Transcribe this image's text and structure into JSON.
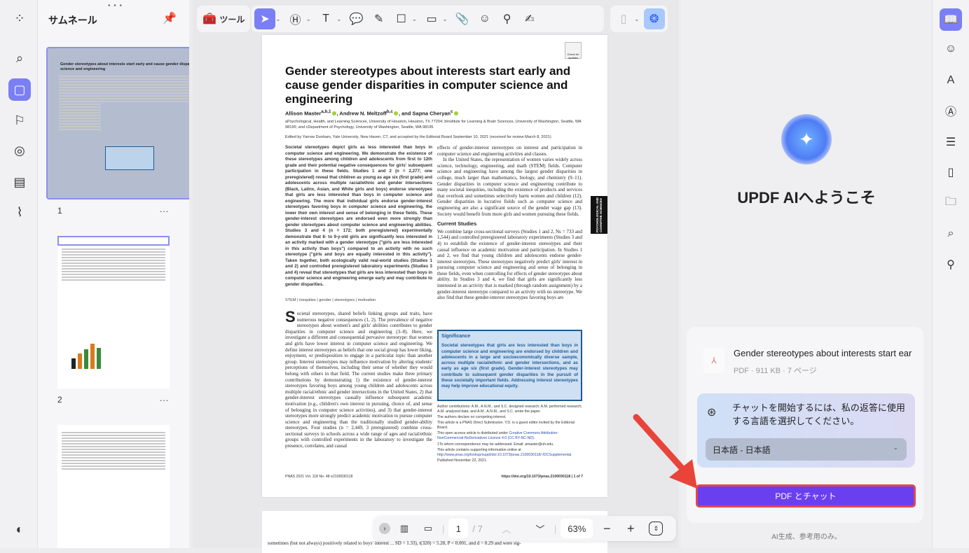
{
  "left_rail": {
    "items": [
      {
        "name": "apps",
        "icon": "grid-icon"
      },
      {
        "name": "search",
        "icon": "search-icon"
      },
      {
        "name": "thumbnails",
        "icon": "page-icon",
        "active": true
      },
      {
        "name": "bookmarks",
        "icon": "bookmark-icon"
      },
      {
        "name": "comments",
        "icon": "comment-icon"
      },
      {
        "name": "attachments-file",
        "icon": "file-icon"
      },
      {
        "name": "attachments",
        "icon": "paperclip-icon"
      }
    ]
  },
  "thumbnails": {
    "title": "サムネール",
    "pages": [
      {
        "number": "1"
      },
      {
        "number": "2"
      }
    ],
    "more": "..."
  },
  "toolbar": {
    "tools_label": "ツール"
  },
  "paper": {
    "title": "Gender stereotypes about interests start early and cause gender disparities in computer science and engineering",
    "authors": [
      "Allison Master",
      "a,b,1",
      ", Andrew N. Meltzoff",
      "b,c",
      ", and Sapna Cheryan",
      "c"
    ],
    "affiliations": "aPsychological, Health, and Learning Sciences, University of Houston, Houston, TX 77204; bInstitute for Learning & Brain Sciences, University of Washington, Seattle, WA 98195; and cDepartment of Psychology, University of Washington, Seattle, WA 98195",
    "edited": "Edited by Yarrow Dunham, Yale University, New Haven, CT, and accepted by the Editorial Board September 10, 2021 (received for review March 8, 2021)",
    "abstract": "Societal stereotypes depict girls as less interested than boys in computer science and engineering. We demonstrate the existence of these stereotypes among children and adolescents from first to 12th grade and their potential negative consequences for girls' subsequent participation in these fields. Studies 1 and 2 (n = 2,277; one preregistered) reveal that children as young as age six (first grade) and adolescents across multiple racial/ethnic and gender intersections (Black, Latinx, Asian, and White girls and boys) endorse stereotypes that girls are less interested than boys in computer science and engineering. The more that individual girls endorse gender-interest stereotypes favoring boys in computer science and engineering, the lower their own interest and sense of belonging in these fields. These gender-interest stereotypes are endorsed even more strongly than gender stereotypes about computer science and engineering abilities. Studies 3 and 4 (n = 172; both preregistered) experimentally demonstrate that 8- to 9-y-old girls are significantly less interested in an activity marked with a gender stereotype (\"girls are less interested in this activity than boys\") compared to an activity with no such stereotype (\"girls and boys are equally interested in this activity\"). Taken together, both ecologically valid real-world studies (Studies 1 and 2) and controlled preregistered laboratory experiments (Studies 3 and 4) reveal that stereotypes that girls are less interested than boys in computer science and engineering emerge early and may contribute to gender disparities.",
    "keywords": "STEM | inequities | gender | stereotypes | motivation",
    "intro_drop": "S",
    "intro": "ocietal stereotypes, shared beliefs linking groups and traits, have numerous negative consequences (1, 2). The prevalence of negative stereotypes about women's and girls' abilities contributes to gender disparities in computer science and engineering (3–8). Here, we investigate a different and consequential pervasive stereotype: that women and girls have lower interest in computer science and engineering. We define interest stereotypes as beliefs that one social group has lower liking, enjoyment, or predisposition to engage in a particular topic than another group. Interest stereotypes may influence motivation by altering students' perceptions of themselves, including their sense of whether they would belong with others in that field. The current studies make three primary contributions by demonstrating 1) the existence of gender-interest stereotypes favoring boys among young children and adolescents across multiple racial/ethnic and gender intersections in the United States, 2) that gender-interest stereotypes causally influence subsequent academic motivation (e.g., children's own interest in pursuing, choice of, and sense of belonging in computer science activities), and 3) that gender-interest stereotypes more strongly predict academic motivation to pursue computer science and engineering than the traditionally studied gender-ability stereotypes. Four studies (n = 2,449, 3 preregistered) combine cross-sectional surveys in schools across a wide range of ages and racial/ethnic groups with controlled experiments in the laboratory to investigate the presence, correlates, and causal",
    "col2_p1": "effects of gender-interest stereotypes on interest and participation in computer science and engineering activities and classes.",
    "col2_p2": "In the United States, the representation of women varies widely across science, technology, engineering, and math (STEM) fields. Computer science and engineering have among the largest gender disparities in college, much larger than mathematics, biology, and chemistry (9–11). Gender disparities in computer science and engineering contribute to many societal inequities, including the existence of products and services that overlook and sometimes selectively harm women and children (12). Gender disparities in lucrative fields such as computer science and engineering are also a significant source of the gender wage gap (13). Society would benefit from more girls and women pursuing these fields.",
    "current_heading": "Current Studies",
    "col2_p3": "We combine large cross-sectional surveys (Studies 1 and 2, Ns = 733 and 1,544) and controlled preregistered laboratory experiments (Studies 3 and 4) to establish the existence of gender-interest stereotypes and their causal influence on academic motivation and participation. In Studies 1 and 2, we find that young children and adolescents endorse gender-interest stereotypes. These stereotypes negatively predict girls' interest in pursuing computer science and engineering and sense of belonging in these fields, even when controlling for effects of gender stereotypes about ability. In Studies 3 and 4, we find that girls are significantly less interested in an activity that is marked (through random assignment) by a gender-interest stereotype compared to an activity with no stereotype. We also find that these gender-interest stereotypes favoring boys are",
    "significance_title": "Significance",
    "significance": "Societal stereotypes that girls are less interested than boys in computer science and engineering are endorsed by children and adolescents in a large and socioeconomically diverse sample, across multiple racial/ethnic and gender intersections, and as early as age six (first grade). Gender-interest stereotypes may contribute to subsequent gender disparities in the pursuit of these societally important fields. Addressing interest stereotypes may help improve educational equity.",
    "notes": [
      "Author contributions: A.M., A.N.M., and S.C. designed research; A.M. performed research; A.M. analyzed data; and A.M., A.N.M., and S.C. wrote the paper.",
      "The authors declare no competing interest.",
      "This article is a PNAS Direct Submission. Y.D. is a guest editor invited by the Editorial Board."
    ],
    "license_prefix": "This open access article is distributed under ",
    "license_link": "Creative Commons Attribution-NonCommercial-NoDerivatives License 4.0 (CC BY-NC-ND).",
    "correspondence": "1To whom correspondence may be addressed. Email: amaster@uh.edu.",
    "supp_prefix": "This article contains supporting information online at ",
    "supp_link": "http://www.pnas.org/lookup/suppl/doi:10.1073/pnas.2100030118/-/DCSupplemental.",
    "published": "Published November 22, 2021.",
    "footer_left": "PNAS 2021 Vol. 118 No. 48 e2100030118",
    "footer_right": "https://doi.org/10.1073/pnas.2100030118  |  1 of 7",
    "side_tag": "PSYCHOLOGICAL AND COGNITIVE SCIENCES",
    "crossmark": "Check for updates",
    "page2_text": "sometimes (but not always) positively related to boys' interest ... SD = 1.33), t(320) = 5.28, P < 0.001, and d = 0.29 and were sig-"
  },
  "bottom_bar": {
    "current_page": "1",
    "total_pages": "/ 7",
    "zoom": "63%"
  },
  "ai_panel": {
    "welcome": "UPDF AIへようこそ",
    "file_name": "Gender stereotypes about interests start ear",
    "file_meta": "PDF · 911 KB · 7 ページ",
    "language_prompt": "チャットを開始するには、私の返答に使用する言語を選択してください。",
    "language_selected": "日本語 - 日本語",
    "chat_button": "PDF とチャット",
    "disclaimer": "AI生成、参考用のみ。"
  },
  "colors": {
    "accent": "#7b7ff5",
    "cta": "#6a3ff0",
    "highlight_border": "#e0484e",
    "arrow": "#e8443a"
  }
}
